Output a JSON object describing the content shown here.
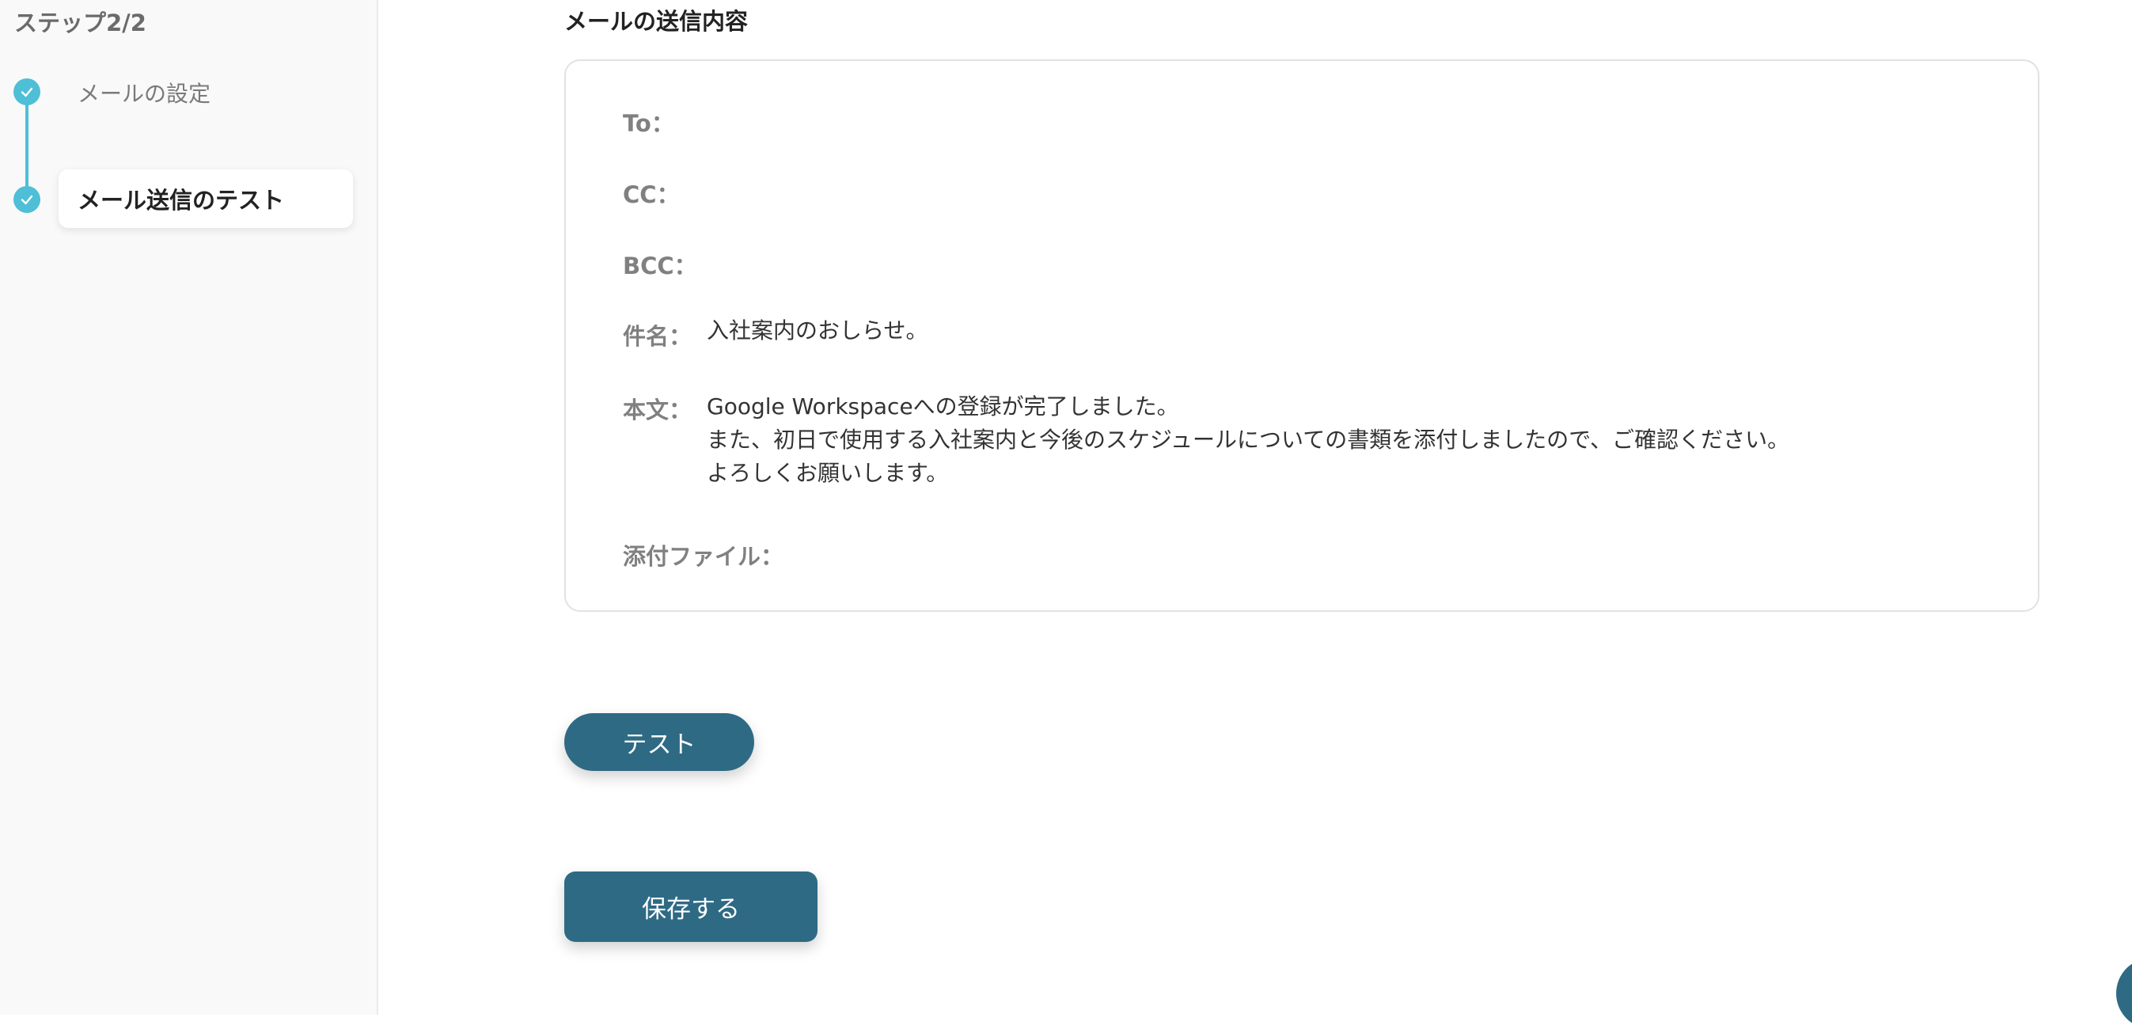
{
  "sidebar": {
    "step_title": "ステップ2/2",
    "steps": [
      {
        "label": "メールの設定",
        "state": "completed"
      },
      {
        "label": "メール送信のテスト",
        "state": "active"
      }
    ]
  },
  "main": {
    "section_title": "メールの送信内容",
    "mail": {
      "to_label": "To：",
      "cc_label": "CC：",
      "bcc_label": "BCC：",
      "subject_label": "件名：",
      "subject_value": "入社案内のおしらせ。",
      "body_label": "本文：",
      "body_lines": [
        "Google Workspaceへの登録が完了しました。",
        "また、初日で使用する入社案内と今後のスケジュールについての書類を添付しましたので、ご確認ください。",
        "よろしくお願いします。"
      ],
      "attachment_label": "添付ファイル："
    },
    "test_button": "テスト",
    "save_button": "保存する"
  },
  "colors": {
    "accent": "#4ebfd7",
    "button": "#2e6a84"
  },
  "icons": {
    "step_completed": "check-icon",
    "help": "help-icon"
  }
}
